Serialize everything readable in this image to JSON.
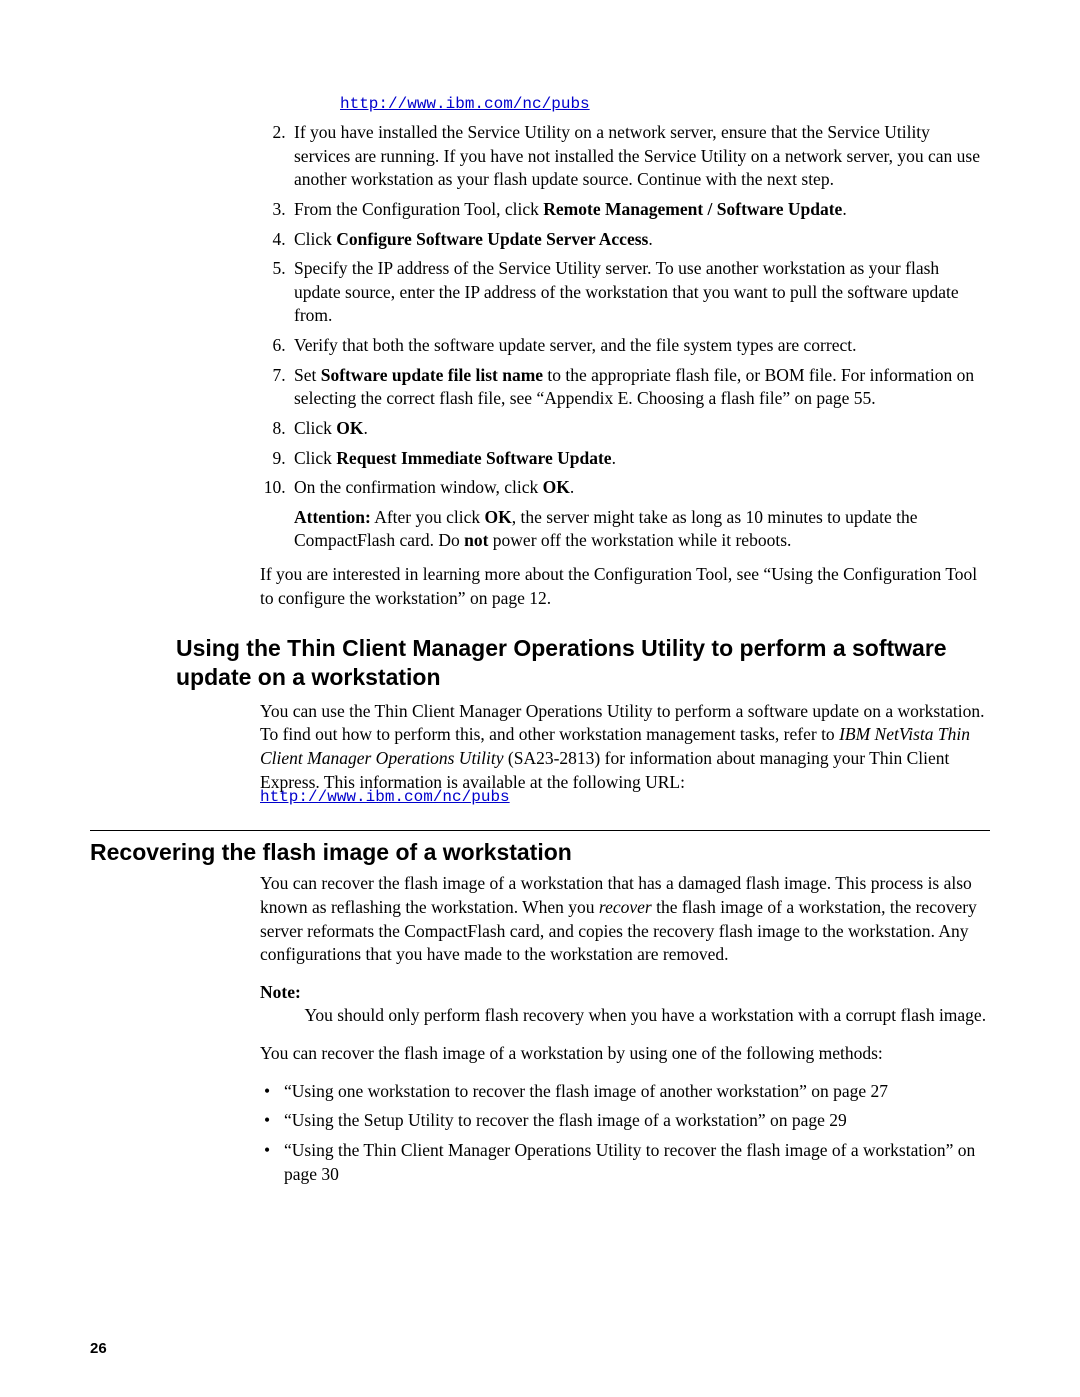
{
  "url_top": "http://www.ibm.com/nc/pubs",
  "steps": {
    "s2": "If you have installed the Service Utility on a network server, ensure that the Service Utility services are running. If you have not installed the Service Utility on a network server, you can use another workstation as your flash update source. Continue with the next step.",
    "s3_a": "From the Configuration Tool, click ",
    "s3_b": "Remote Management / Software Update",
    "s3_c": ".",
    "s4_a": "Click ",
    "s4_b": "Configure Software Update Server Access",
    "s4_c": ".",
    "s5": "Specify the IP address of the Service Utility server. To use another workstation as your flash update source, enter the IP address of the workstation that you want to pull the software update from.",
    "s6": "Verify that both the software update server, and the file system types are correct.",
    "s7_a": "Set ",
    "s7_b": "Software update file list name",
    "s7_c": " to the appropriate flash file, or BOM file. For information on selecting the correct flash file, see “Appendix E. Choosing a flash file” on page 55.",
    "s8_a": "Click ",
    "s8_b": "OK",
    "s8_c": ".",
    "s9_a": "Click ",
    "s9_b": "Request Immediate Software Update",
    "s9_c": ".",
    "s10_a": "On the confirmation window, click ",
    "s10_b": "OK",
    "s10_c": ".",
    "s10_attn_a": "Attention:",
    "s10_attn_b": "   After you click ",
    "s10_attn_c": "OK",
    "s10_attn_d": ", the server might take as long as 10 minutes to update the CompactFlash card. Do ",
    "s10_attn_e": "not",
    "s10_attn_f": " power off the workstation while it reboots."
  },
  "post_list": "If you are interested in learning more about the Configuration Tool, see “Using the Configuration Tool to configure the workstation” on page 12.",
  "h2a": "Using the Thin Client Manager Operations Utility to perform a software update on a workstation",
  "tcm_a": "You can use the Thin Client Manager Operations Utility to perform a software update on a workstation. To find out how to perform this, and other workstation management tasks, refer to ",
  "tcm_b": "IBM NetVista Thin Client Manager Operations Utility",
  "tcm_c": " (SA23-2813) for information about managing your Thin Client Express. This information is available at the following URL:",
  "url_mid": "http://www.ibm.com/nc/pubs",
  "h2b": "Recovering the flash image of a workstation",
  "rec_a": "You can recover the flash image of a workstation that has a damaged flash image. This process is also known as reflashing the workstation. When you ",
  "rec_b": "recover",
  "rec_c": " the flash image of a workstation, the recovery server reformats the CompactFlash card, and copies the recovery flash image to the workstation. Any configurations that you have made to the workstation are removed.",
  "note_a": "Note:",
  "note_b": " You should only perform flash recovery when you have a workstation with a corrupt flash image.",
  "rec_methods": "You can recover the flash image of a workstation by using one of the following methods:",
  "bullets": {
    "b1": "“Using one workstation to recover the flash image of another workstation” on page 27",
    "b2": "“Using the Setup Utility to recover the flash image of a workstation” on page 29",
    "b3": "“Using the Thin Client Manager Operations Utility to recover the flash image of a workstation” on page 30"
  },
  "page_number": "26"
}
